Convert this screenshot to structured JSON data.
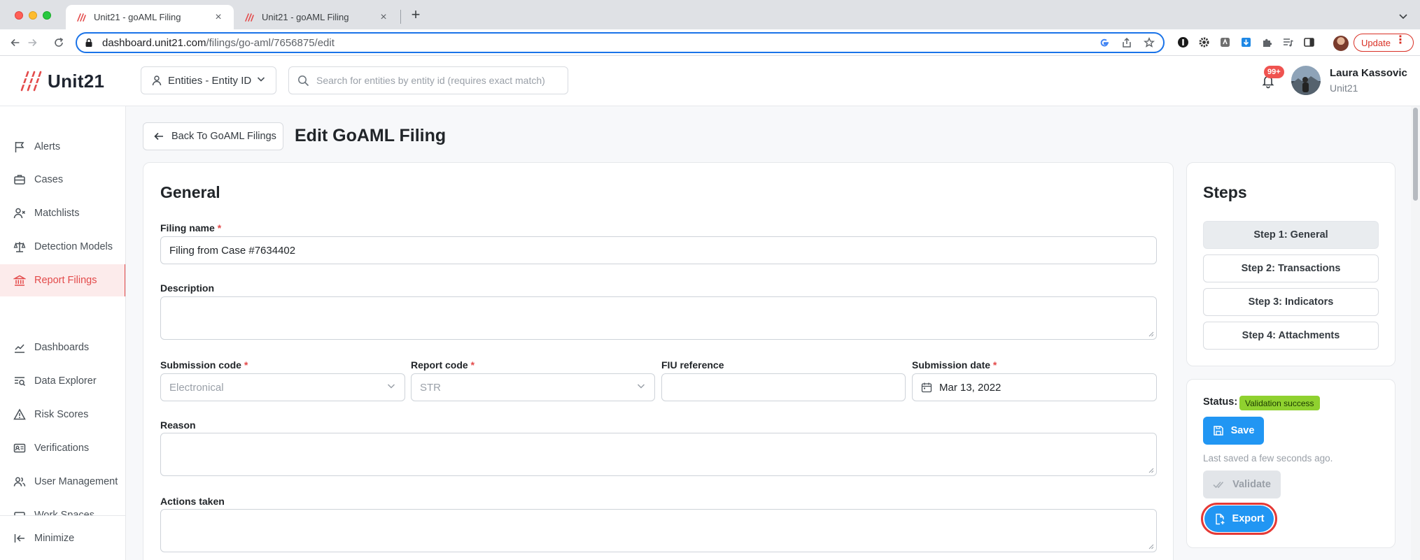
{
  "browser": {
    "tabs": [
      {
        "title": "Unit21 - goAML Filing",
        "active": true
      },
      {
        "title": "Unit21 - goAML Filing",
        "active": false
      }
    ],
    "new_tab_label": "+",
    "close_label": "×",
    "url_host": "dashboard.unit21.com",
    "url_path": "/filings/go-aml/7656875/edit",
    "update_label": "Update",
    "update_menu": "⋮"
  },
  "header": {
    "logo_text": "Unit21",
    "entity_select": "Entities - Entity ID",
    "search_placeholder": "Search for entities by entity id (requires exact match)",
    "notification_count": "99+",
    "user_name": "Laura Kassovic",
    "user_org": "Unit21"
  },
  "sidebar": {
    "items": [
      {
        "label": "Alerts",
        "icon": "flag-icon"
      },
      {
        "label": "Cases",
        "icon": "briefcase-icon"
      },
      {
        "label": "Matchlists",
        "icon": "user-x-icon"
      },
      {
        "label": "Detection Models",
        "icon": "scale-icon"
      },
      {
        "label": "Report Filings",
        "icon": "bank-icon",
        "active": true
      },
      {
        "label": "Dashboards",
        "icon": "chart-line-icon"
      },
      {
        "label": "Data Explorer",
        "icon": "search-list-icon"
      },
      {
        "label": "Risk Scores",
        "icon": "warning-icon"
      },
      {
        "label": "Verifications",
        "icon": "id-card-icon"
      },
      {
        "label": "User Management",
        "icon": "users-icon"
      },
      {
        "label": "Work Spaces",
        "icon": "workspace-icon"
      }
    ],
    "minimize_label": "Minimize"
  },
  "page": {
    "back_label": "Back To GoAML Filings",
    "title": "Edit GoAML Filing"
  },
  "general": {
    "title": "General",
    "filing_name_label": "Filing name",
    "filing_name_value": "Filing from Case #7634402",
    "description_label": "Description",
    "submission_code_label": "Submission code",
    "submission_code_value": "Electronical",
    "report_code_label": "Report code",
    "report_code_value": "STR",
    "fiu_reference_label": "FIU reference",
    "fiu_reference_value": "",
    "submission_date_label": "Submission date",
    "submission_date_value": "Mar 13, 2022",
    "reason_label": "Reason",
    "actions_taken_label": "Actions taken",
    "required_mark": "*"
  },
  "steps": {
    "title": "Steps",
    "items": [
      "Step 1: General",
      "Step 2: Transactions",
      "Step 3: Indicators",
      "Step 4: Attachments"
    ],
    "current_index": 0
  },
  "status": {
    "label": "Status:",
    "badge": "Validation success",
    "save_label": "Save",
    "last_saved": "Last saved a few seconds ago.",
    "validate_label": "Validate",
    "export_label": "Export"
  },
  "colors": {
    "accent_red": "#e34a4a",
    "primary_blue": "#2196f3",
    "success_green": "#8fd12f",
    "highlight_ring": "#e53935"
  }
}
